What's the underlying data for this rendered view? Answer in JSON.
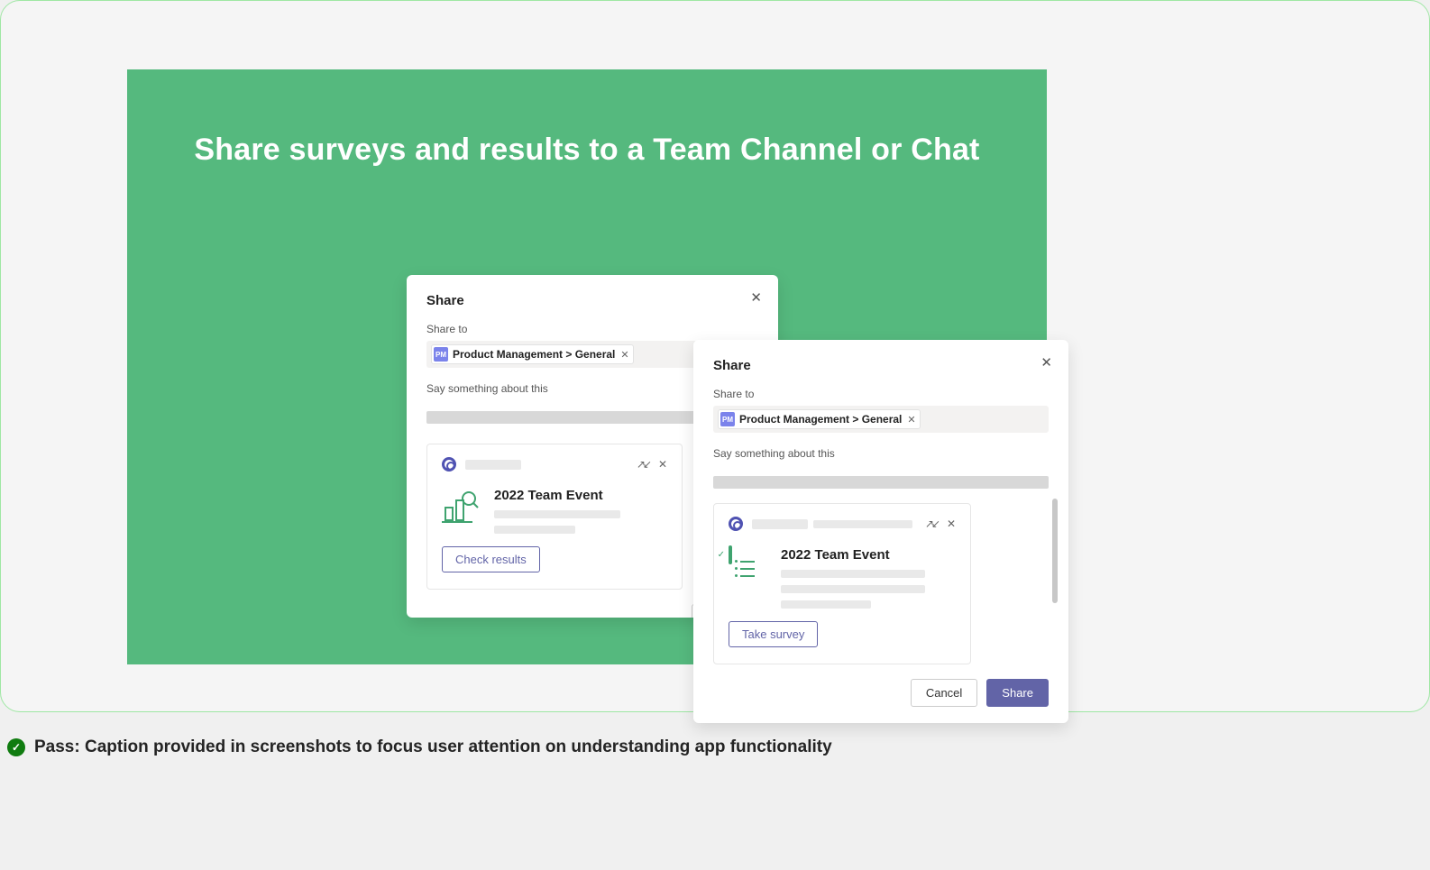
{
  "headline": "Share surveys and results to a Team Channel or Chat",
  "dialog_common": {
    "title": "Share",
    "share_to_label": "Share to",
    "chip_icon_text": "PM",
    "chip_text": "Product Management > General",
    "say_label": "Say something about this",
    "cancel": "Cancel",
    "share": "Share"
  },
  "left_dialog": {
    "card_title": "2022 Team Event",
    "action": "Check results"
  },
  "right_dialog": {
    "card_title": "2022 Team Event",
    "action": "Take survey"
  },
  "caption": "Pass: Caption provided in screenshots to focus user attention on understanding app functionality"
}
